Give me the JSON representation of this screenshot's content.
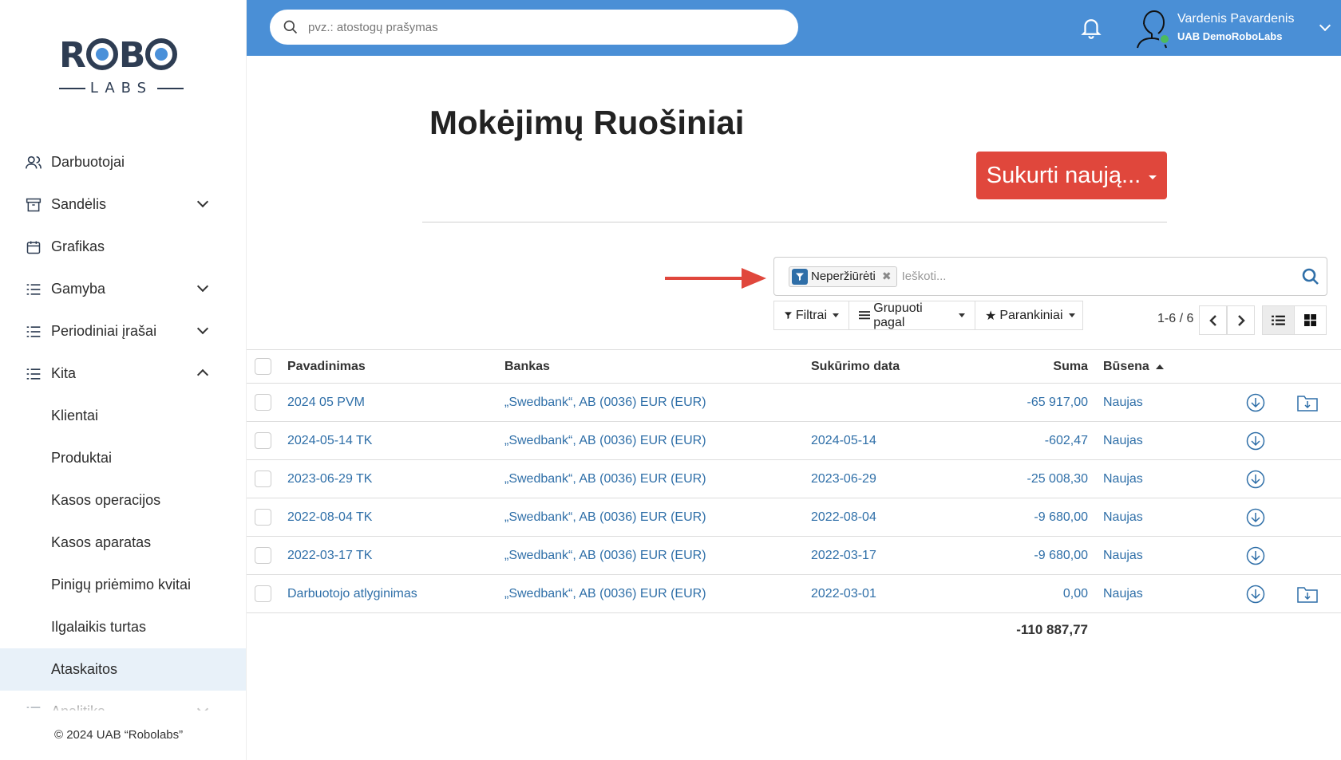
{
  "sidebar": {
    "logo": {
      "word": "ROBO",
      "sub": "LABS"
    },
    "items": [
      {
        "label": "Darbuotojai",
        "icon": "users-icon"
      },
      {
        "label": "Sandėlis",
        "icon": "archive-icon"
      },
      {
        "label": "Grafikas",
        "icon": "calendar-icon"
      },
      {
        "label": "Gamyba",
        "icon": "list-icon"
      },
      {
        "label": "Periodiniai įrašai",
        "icon": "list-icon"
      },
      {
        "label": "Kita",
        "icon": "list-icon"
      },
      {
        "label": "Klientai"
      },
      {
        "label": "Produktai"
      },
      {
        "label": "Kasos operacijos"
      },
      {
        "label": "Kasos aparatas"
      },
      {
        "label": "Pinigų priėmimo kvitai"
      },
      {
        "label": "Ilgalaikis turtas"
      },
      {
        "label": "Ataskaitos"
      },
      {
        "label": "Analitika",
        "icon": "list-icon"
      }
    ],
    "footer": "© 2024 UAB “Robolabs”"
  },
  "topbar": {
    "search_placeholder": "pvz.: atostogų prašymas",
    "user_name": "Vardenis Pavardenis",
    "user_company": "UAB DemoRoboLabs"
  },
  "main": {
    "title": "Mokėjimų Ruošiniai",
    "create_button": "Sukurti naują...",
    "facet_label": "Neperžiūrėti",
    "search_placeholder": "Ieškoti...",
    "filters_label": "Filtrai",
    "group_label": "Grupuoti pagal",
    "favorites_label": "Parankiniai",
    "pager": "1-6 / 6"
  },
  "table": {
    "columns": {
      "name": "Pavadinimas",
      "bank": "Bankas",
      "date": "Sukūrimo data",
      "sum": "Suma",
      "status": "Būsena"
    },
    "rows": [
      {
        "name": "2024 05 PVM",
        "bank": "„Swedbank“, AB (0036) EUR (EUR)",
        "date": "",
        "sum": "-65 917,00",
        "status": "Naujas",
        "folder": true
      },
      {
        "name": "2024-05-14 TK",
        "bank": "„Swedbank“, AB (0036) EUR (EUR)",
        "date": "2024-05-14",
        "sum": "-602,47",
        "status": "Naujas",
        "folder": false
      },
      {
        "name": "2023-06-29 TK",
        "bank": "„Swedbank“, AB (0036) EUR (EUR)",
        "date": "2023-06-29",
        "sum": "-25 008,30",
        "status": "Naujas",
        "folder": false
      },
      {
        "name": "2022-08-04 TK",
        "bank": "„Swedbank“, AB (0036) EUR (EUR)",
        "date": "2022-08-04",
        "sum": "-9 680,00",
        "status": "Naujas",
        "folder": false
      },
      {
        "name": "2022-03-17 TK",
        "bank": "„Swedbank“, AB (0036) EUR (EUR)",
        "date": "2022-03-17",
        "sum": "-9 680,00",
        "status": "Naujas",
        "folder": false
      },
      {
        "name": "Darbuotojo atlyginimas",
        "bank": "„Swedbank“, AB (0036) EUR (EUR)",
        "date": "2022-03-01",
        "sum": "0,00",
        "status": "Naujas",
        "folder": true
      }
    ],
    "total": "-110 887,77"
  },
  "colors": {
    "topbar": "#4a8fd6",
    "accent_red": "#e0473c",
    "link": "#2f6fa8",
    "active_bg": "#e8f1f9"
  }
}
